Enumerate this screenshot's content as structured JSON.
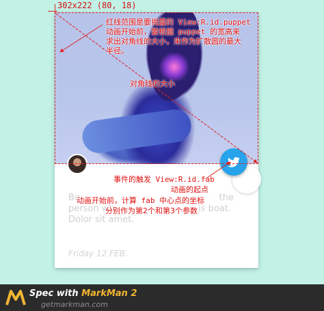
{
  "spec": {
    "dimension_label": "302x222 (80, 18)"
  },
  "annotations": {
    "red_area": "红线范围是要揭露的 View:R.id.puppet 动画开始前，要根据 puppet 的宽高来求出对角线的大小，来作为扩散圆的最大半径。",
    "red_area_lines": [
      "红线范围是要揭露的 View:R.id.puppet",
      "动画开始前，要根据 puppet 的宽高来",
      "求出对角线的大小，来作为扩散圆的最大",
      "半径。"
    ],
    "diagonal": "对角线的大小",
    "trigger_lines": [
      "事件的触发 View:R.id.fab",
      "动画的起点"
    ],
    "center_lines": [
      "动画开始前，计算 fab 中心点的坐标",
      "分别作为第2个和第3个参数"
    ]
  },
  "card": {
    "body_text": "Be... the person who... is boat. Dolor sit amet.",
    "body_lines": [
      "Be",
      "person wh",
      "Dolor sit amet."
    ],
    "body_line1_right": "the",
    "body_line2_right": "is boat.",
    "date": "Friday 12 FEB."
  },
  "footer": {
    "title_prefix": "Spec with ",
    "title_brand": "MarkMan 2",
    "url": "getmarkman.com"
  },
  "colors": {
    "marker": "#e02020",
    "fab": "#26a3ea",
    "background": "#c2f2e6",
    "footer": "#2b2b2b",
    "brand": "#f2b632"
  }
}
